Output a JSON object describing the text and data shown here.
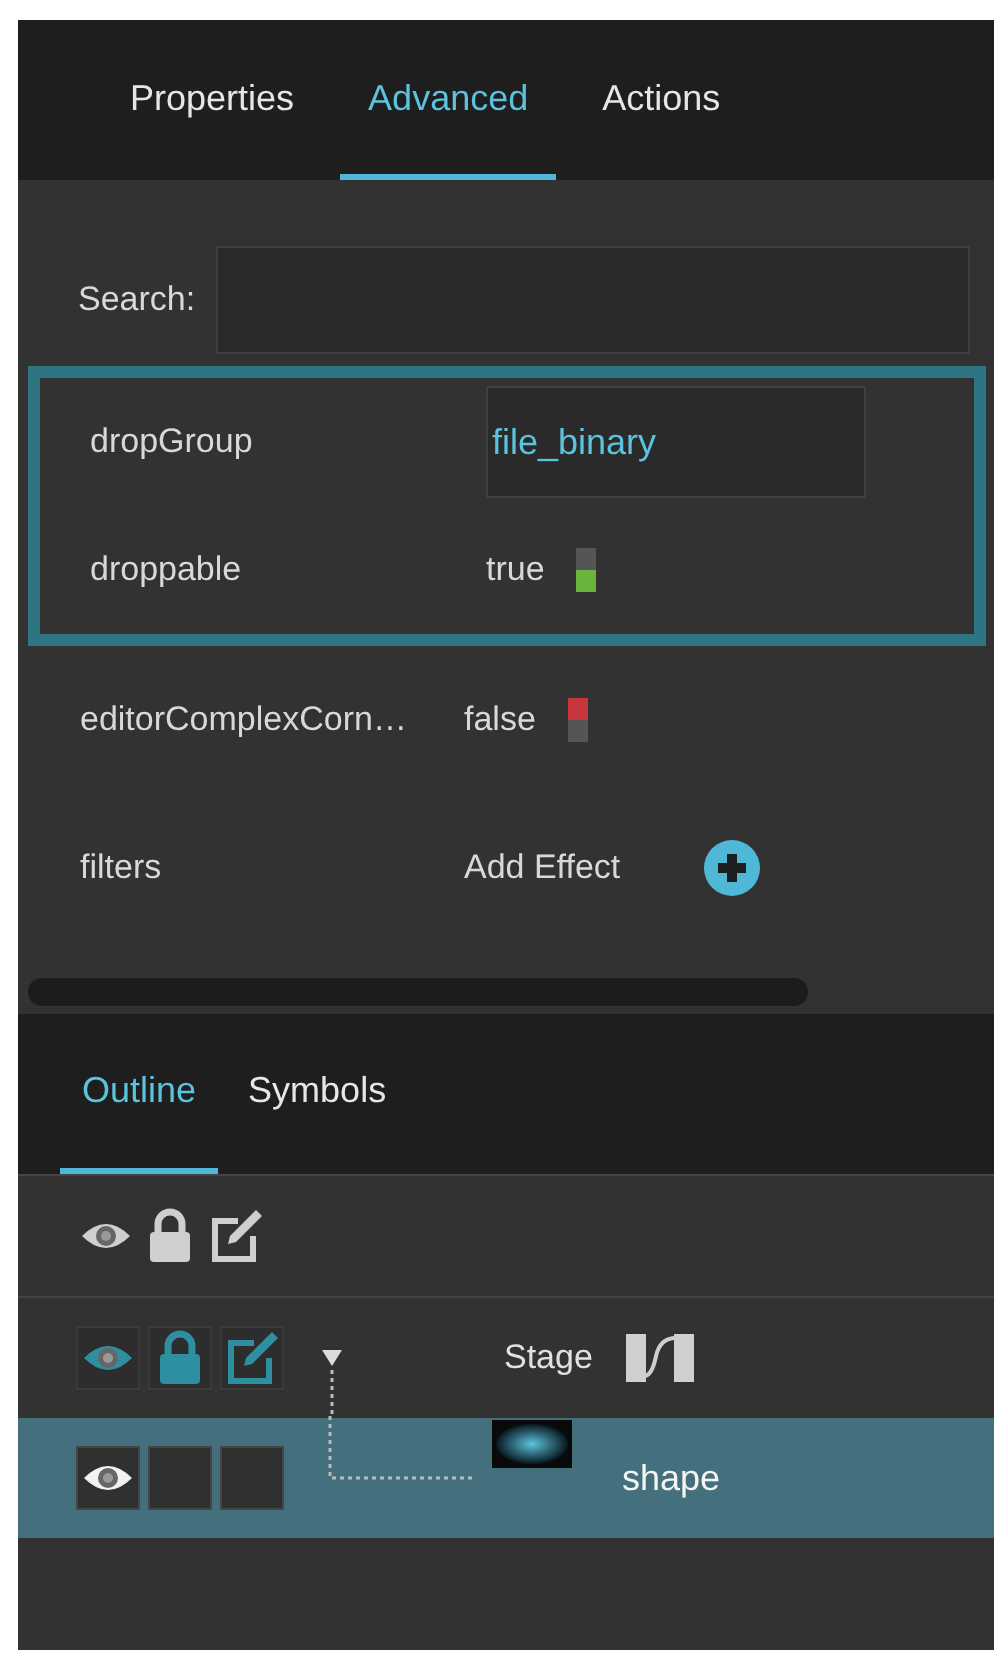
{
  "tabs": [
    {
      "label": "Properties",
      "selected": false
    },
    {
      "label": "Advanced",
      "selected": true
    },
    {
      "label": "Actions",
      "selected": false
    }
  ],
  "search": {
    "label": "Search:"
  },
  "properties": [
    {
      "name": "dropGroup",
      "kind": "field",
      "value": "file_binary",
      "highlighted": true
    },
    {
      "name": "droppable",
      "kind": "boolean",
      "value": "true",
      "on": true,
      "highlighted": true
    },
    {
      "name": "editorComplexCorn…",
      "kind": "boolean",
      "value": "false",
      "on": false,
      "highlighted": false
    },
    {
      "name": "filters",
      "kind": "action",
      "value": "Add Effect",
      "highlighted": false
    }
  ],
  "outline": {
    "tabs": [
      {
        "label": "Outline",
        "selected": true
      },
      {
        "label": "Symbols",
        "selected": false
      }
    ],
    "layers": [
      {
        "name": "Stage",
        "kind": "stage",
        "selected": false,
        "expanded": true,
        "children": [
          {
            "name": "shape",
            "kind": "shape",
            "selected": true
          }
        ]
      }
    ]
  }
}
